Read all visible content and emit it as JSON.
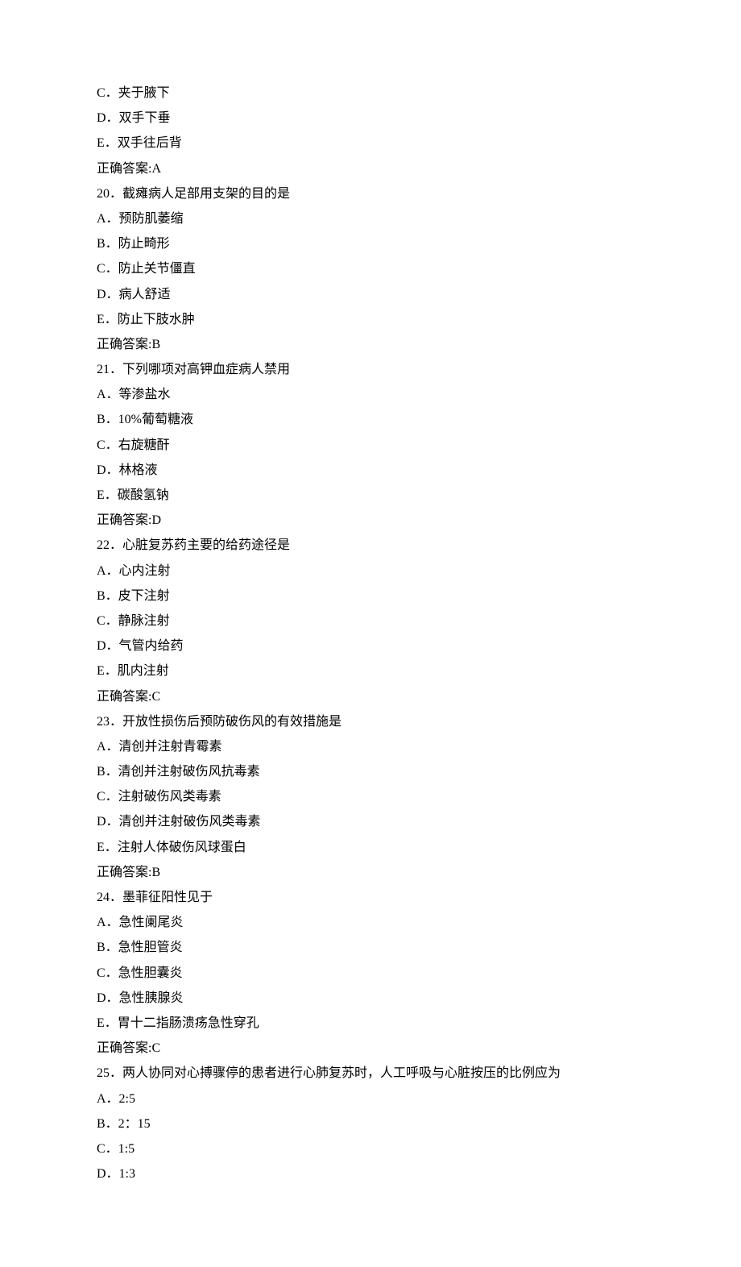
{
  "lines": [
    "C．夹于腋下",
    "D．双手下垂",
    "E．双手往后背",
    "正确答案:A",
    "20．截瘫病人足部用支架的目的是",
    "A．预防肌萎缩",
    "B．防止畸形",
    "C．防止关节僵直",
    "D．病人舒适",
    "E．防止下肢水肿",
    "正确答案:B",
    "21．下列哪项对高钾血症病人禁用",
    "A．等渗盐水",
    "B．10%葡萄糖液",
    "C．右旋糖酐",
    "D．林格液",
    "E．碳酸氢钠",
    "正确答案:D",
    "22．心脏复苏药主要的给药途径是",
    "A．心内注射",
    "B．皮下注射",
    "C．静脉注射",
    "D．气管内给药",
    "E．肌内注射",
    "正确答案:C",
    "23．开放性损伤后预防破伤风的有效措施是",
    "A．清创并注射青霉素",
    "B．清创并注射破伤风抗毒素",
    "C．注射破伤风类毒素",
    "D．清创并注射破伤风类毒素",
    "E．注射人体破伤风球蛋白",
    "正确答案:B",
    "24．墨菲征阳性见于",
    "A．急性阑尾炎",
    "B．急性胆管炎",
    "C．急性胆囊炎",
    "D．急性胰腺炎",
    "E．胃十二指肠溃疡急性穿孔",
    "正确答案:C",
    "25．两人协同对心搏骤停的患者进行心肺复苏时，人工呼吸与心脏按压的比例应为",
    "A．2:5",
    "B．2：15",
    "C．1:5",
    "D．1:3"
  ]
}
